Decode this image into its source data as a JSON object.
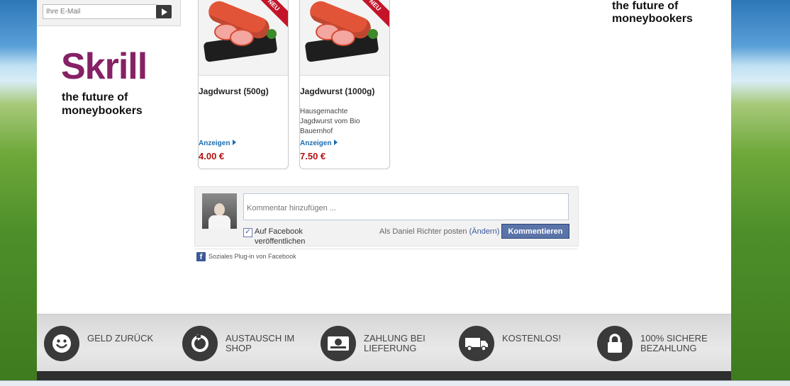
{
  "newsletter": {
    "email_placeholder": "Ihre E-Mail"
  },
  "skrill": {
    "logo_text": "Skrill",
    "tagline_line1": "the future of",
    "tagline_line2": "moneybookers"
  },
  "products": [
    {
      "name": "Jagdwurst (500g)",
      "description": "",
      "link_label": "Anzeigen",
      "price": "4.00 €",
      "badge": "NEU"
    },
    {
      "name": "Jagdwurst (1000g)",
      "description": "Hausgemachte Jagdwurst vom Bio Bauernhof",
      "link_label": "Anzeigen",
      "price": "7.50 €",
      "badge": "NEU"
    }
  ],
  "facebook": {
    "comment_placeholder": "Kommentar hinzufügen ...",
    "publish_label_line1": "Auf Facebook",
    "publish_label_line2": "veröffentlichen",
    "publish_checked": true,
    "posting_as": "Als Daniel Richter posten",
    "change_label": "(Ändern)",
    "submit_label": "Kommentieren",
    "plugin_label": "Soziales Plug-in von Facebook",
    "accent_color": "#3b5998"
  },
  "footer": {
    "features": [
      {
        "line1": "Geld zurück",
        "line2": "",
        "icon": "smiley-icon"
      },
      {
        "line1": "Austausch im",
        "line2": "Shop",
        "icon": "refresh-icon"
      },
      {
        "line1": "Zahlung bei",
        "line2": "Lieferung",
        "icon": "cash-icon"
      },
      {
        "line1": "Kostenlos!",
        "line2": "",
        "icon": "truck-icon"
      },
      {
        "line1": "100% sichere",
        "line2": "Bezahlung",
        "icon": "lock-icon"
      }
    ]
  },
  "colors": {
    "skrill_brand": "#862165",
    "price": "#b31212",
    "link": "#1a6cb0"
  }
}
